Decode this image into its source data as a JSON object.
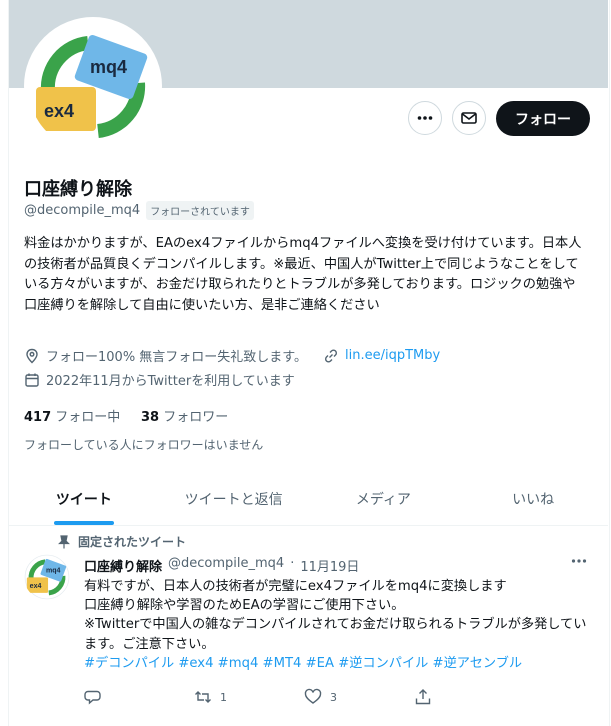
{
  "profile": {
    "name": "口座縛り解除",
    "handle": "@decompile_mq4",
    "follows_you": "フォローされています",
    "follow_label": "フォロー",
    "bio": "料金はかかりますが、EAのex4ファイルからmq4ファイルへ変換を受け付けています。日本人の技術者が品質良くデコンパイルします。※最近、中国人がTwitter上で同じようなことをしている方々がいますが、お金だけ取られたりとトラブルが多発しております。ロジックの勉強や口座縛りを解除して自由に使いたい方、是非ご連絡ください",
    "location": "フォロー100% 無言フォロー失礼致します。",
    "link": "lin.ee/iqpTMby",
    "joined": "2022年11月からTwitterを利用しています",
    "following_count": "417",
    "following_label": "フォロー中",
    "followers_count": "38",
    "followers_label": "フォロワー",
    "no_mutual": "フォローしている人にフォロワーはいません",
    "avatar_text_top": "mq4",
    "avatar_text_bottom": "ex4"
  },
  "tabs": [
    {
      "label": "ツイート"
    },
    {
      "label": "ツイートと返信"
    },
    {
      "label": "メディア"
    },
    {
      "label": "いいね"
    }
  ],
  "tweet": {
    "pinned_label": "固定されたツイート",
    "name": "口座縛り解除",
    "handle": "@decompile_mq4",
    "sep": "·",
    "date": "11月19日",
    "line1": "有料ですが、日本人の技術者が完璧にex4ファイルをmq4に変換します",
    "line2": "口座縛り解除や学習のためEAの学習にご使用下さい。",
    "line3": "※Twitterで中国人の雑なデコンパイルされてお金だけ取られるトラブルが多発しています。ご注意下さい。",
    "hashtags": "#デコンパイル #ex4 #mq4 #MT4 #EA #逆コンパイル #逆アセンブル",
    "retweets": "1",
    "likes": "3"
  },
  "colors": {
    "accent": "#1d9bf0",
    "text": "#0f1419",
    "muted": "#536471"
  }
}
